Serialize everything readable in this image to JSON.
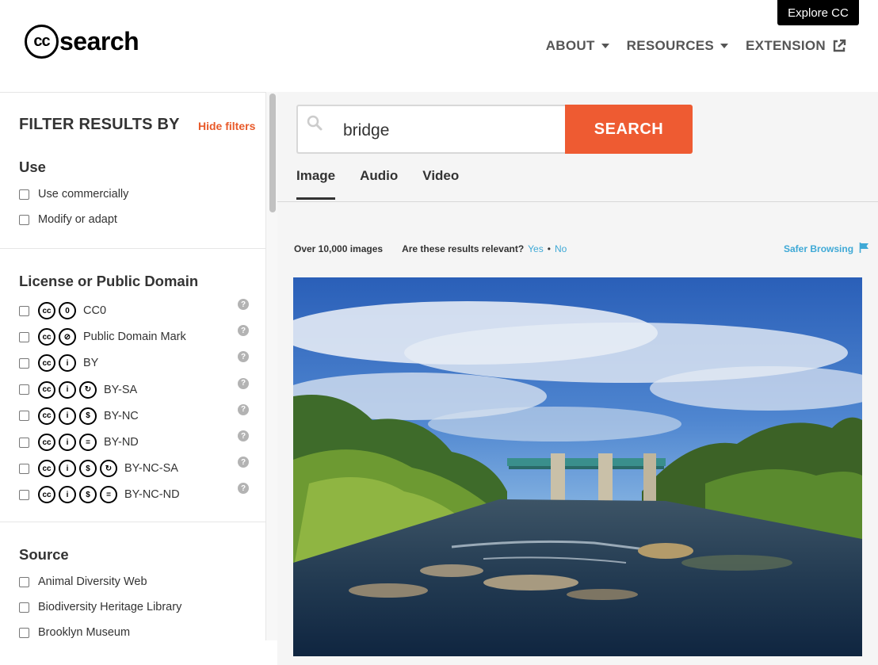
{
  "header": {
    "explore_label": "Explore CC",
    "logo_cc": "cc",
    "logo_text": "search",
    "nav": [
      {
        "label": "ABOUT",
        "icon": "caret-down-icon"
      },
      {
        "label": "RESOURCES",
        "icon": "caret-down-icon"
      },
      {
        "label": "EXTENSION",
        "icon": "external-link-icon"
      }
    ]
  },
  "sidebar": {
    "title": "FILTER RESULTS BY",
    "hide_label": "Hide filters",
    "use": {
      "title": "Use",
      "items": [
        "Use commercially",
        "Modify or adapt"
      ]
    },
    "license": {
      "title": "License or Public Domain",
      "items": [
        {
          "label": "CC0",
          "icons": [
            "cc",
            "zero"
          ]
        },
        {
          "label": "Public Domain Mark",
          "icons": [
            "cc",
            "pd"
          ]
        },
        {
          "label": "BY",
          "icons": [
            "cc",
            "by"
          ]
        },
        {
          "label": "BY-SA",
          "icons": [
            "cc",
            "by",
            "sa"
          ]
        },
        {
          "label": "BY-NC",
          "icons": [
            "cc",
            "by",
            "nc"
          ]
        },
        {
          "label": "BY-ND",
          "icons": [
            "cc",
            "by",
            "nd"
          ]
        },
        {
          "label": "BY-NC-SA",
          "icons": [
            "cc",
            "by",
            "nc",
            "sa"
          ]
        },
        {
          "label": "BY-NC-ND",
          "icons": [
            "cc",
            "by",
            "nc",
            "nd"
          ]
        }
      ]
    },
    "source": {
      "title": "Source",
      "items": [
        "Animal Diversity Web",
        "Biodiversity Heritage Library",
        "Brooklyn Museum"
      ]
    }
  },
  "search": {
    "value": "bridge",
    "button_label": "SEARCH"
  },
  "tabs": [
    {
      "label": "Image",
      "active": true
    },
    {
      "label": "Audio",
      "active": false
    },
    {
      "label": "Video",
      "active": false
    }
  ],
  "results": {
    "count": "Over 10,000 images",
    "relevant_q": "Are these results relevant?",
    "yes": "Yes",
    "no": "No",
    "safer": "Safer Browsing"
  },
  "colors": {
    "accent": "#ee5b32",
    "link": "#3fa9d6"
  }
}
